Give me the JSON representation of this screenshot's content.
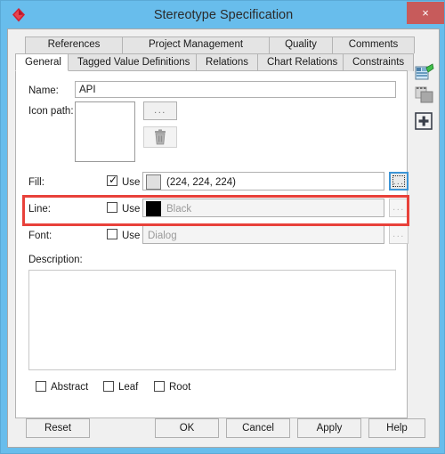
{
  "window": {
    "title": "Stereotype Specification",
    "app_icon": "red-diamond-icon",
    "close_label": "×"
  },
  "tabs": {
    "row1": [
      {
        "label": "References",
        "active": false
      },
      {
        "label": "Project Management",
        "active": false
      },
      {
        "label": "Quality",
        "active": false
      },
      {
        "label": "Comments",
        "active": false
      }
    ],
    "row2": [
      {
        "label": "General",
        "active": true
      },
      {
        "label": "Tagged Value Definitions",
        "active": false
      },
      {
        "label": "Relations",
        "active": false
      },
      {
        "label": "Chart Relations",
        "active": false
      },
      {
        "label": "Constraints",
        "active": false
      }
    ]
  },
  "side_icons": [
    {
      "name": "new-element-icon"
    },
    {
      "name": "clone-element-icon"
    },
    {
      "name": "add-plus-icon",
      "glyph": "+"
    }
  ],
  "form": {
    "name": {
      "label": "Name:",
      "value": "API"
    },
    "icon_path": {
      "label": "Icon path:",
      "value": ""
    },
    "browse_label": "...",
    "delete_icon": "trash-icon",
    "fill": {
      "label": "Fill:",
      "use_label": "Use",
      "use_checked": true,
      "value": "(224, 224, 224)",
      "swatch_color": "#e0e0e0",
      "browse_label": "...",
      "highlighted": true
    },
    "line": {
      "label": "Line:",
      "use_label": "Use",
      "use_checked": false,
      "value": "Black",
      "swatch_color": "#000000",
      "browse_label": "..."
    },
    "font": {
      "label": "Font:",
      "use_label": "Use",
      "use_checked": false,
      "value": "Dialog",
      "browse_label": "..."
    },
    "description": {
      "label": "Description:",
      "value": ""
    },
    "flags": [
      {
        "label": "Abstract",
        "checked": false
      },
      {
        "label": "Leaf",
        "checked": false
      },
      {
        "label": "Root",
        "checked": false
      }
    ]
  },
  "buttons": [
    {
      "label": "Reset"
    },
    {
      "label": "OK"
    },
    {
      "label": "Cancel"
    },
    {
      "label": "Apply"
    },
    {
      "label": "Help"
    }
  ],
  "colors": {
    "window_frame": "#68bdec",
    "close_button": "#c75b5b",
    "highlight": "#e8413a",
    "panel_bg": "#f0f0f0"
  }
}
